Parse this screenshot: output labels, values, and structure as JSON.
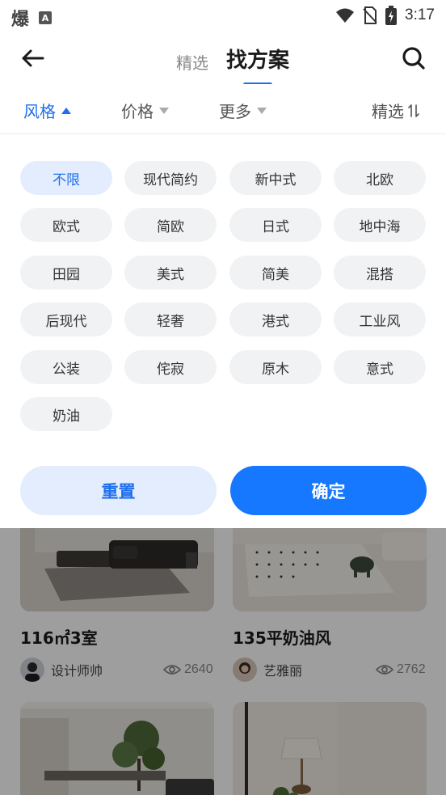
{
  "status_bar": {
    "app_glyph": "爆",
    "a_icon": "A",
    "time": "3:17"
  },
  "header": {
    "tabs": [
      {
        "label": "精选",
        "active": false
      },
      {
        "label": "找方案",
        "active": true
      }
    ]
  },
  "filter_bar": {
    "style_label": "风格",
    "price_label": "价格",
    "more_label": "更多",
    "select_label": "精选",
    "active_color": "#1f6feb"
  },
  "styles": [
    "不限",
    "现代简约",
    "新中式",
    "北欧",
    "欧式",
    "简欧",
    "日式",
    "地中海",
    "田园",
    "美式",
    "简美",
    "混搭",
    "后现代",
    "轻奢",
    "港式",
    "工业风",
    "公装",
    "侘寂",
    "原木",
    "意式",
    "奶油"
  ],
  "selected_style": "不限",
  "actions": {
    "reset_label": "重置",
    "confirm_label": "确定"
  },
  "cards": [
    {
      "title": "116㎡3室",
      "author": "设计师帅",
      "views": "2640"
    },
    {
      "title": "135平奶油风",
      "author": "艺雅丽",
      "views": "2762"
    }
  ],
  "colors": {
    "accent": "#1677ff",
    "chip_bg": "#f1f2f4",
    "chip_selected_bg": "#e3edfd"
  }
}
